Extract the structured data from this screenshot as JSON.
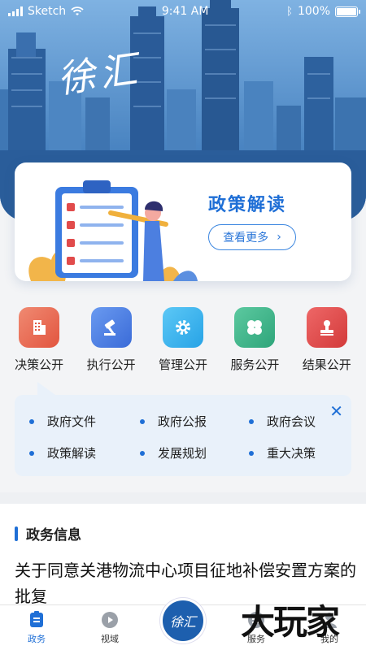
{
  "status_bar": {
    "carrier": "Sketch",
    "time": "9:41 AM",
    "battery": "100%"
  },
  "hero": {
    "logo_text": "徐汇"
  },
  "policy_card": {
    "title": "政策解读",
    "more_label": "查看更多"
  },
  "quick_entries": [
    {
      "label": "决策公开",
      "icon": "building-icon",
      "color": "#ea6a55"
    },
    {
      "label": "执行公开",
      "icon": "gavel-icon",
      "color": "#4a7fe6"
    },
    {
      "label": "管理公开",
      "icon": "gear-icon",
      "color": "#37b4ef"
    },
    {
      "label": "服务公开",
      "icon": "clover-icon",
      "color": "#3cb48c"
    },
    {
      "label": "结果公开",
      "icon": "stamp-icon",
      "color": "#e24b4b"
    }
  ],
  "sub_menu": {
    "items": [
      "政府文件",
      "政府公报",
      "政府会议",
      "政策解读",
      "发展规划",
      "重大决策"
    ]
  },
  "section": {
    "title": "政务信息"
  },
  "news": {
    "headline": "关于同意关港物流中心项目征地补偿安置方案的批复"
  },
  "tabbar": {
    "items": [
      {
        "label": "政务",
        "icon": "document-icon"
      },
      {
        "label": "视域",
        "icon": "play-icon"
      },
      {
        "label": "",
        "icon": "logo-icon"
      },
      {
        "label": "服务",
        "icon": "service-icon"
      },
      {
        "label": "我的",
        "icon": "user-icon"
      }
    ]
  },
  "watermark": "大玩家",
  "colors": {
    "primary": "#1f6fd6",
    "hero": "#2b64a6",
    "panel": "#e9f1fa"
  }
}
